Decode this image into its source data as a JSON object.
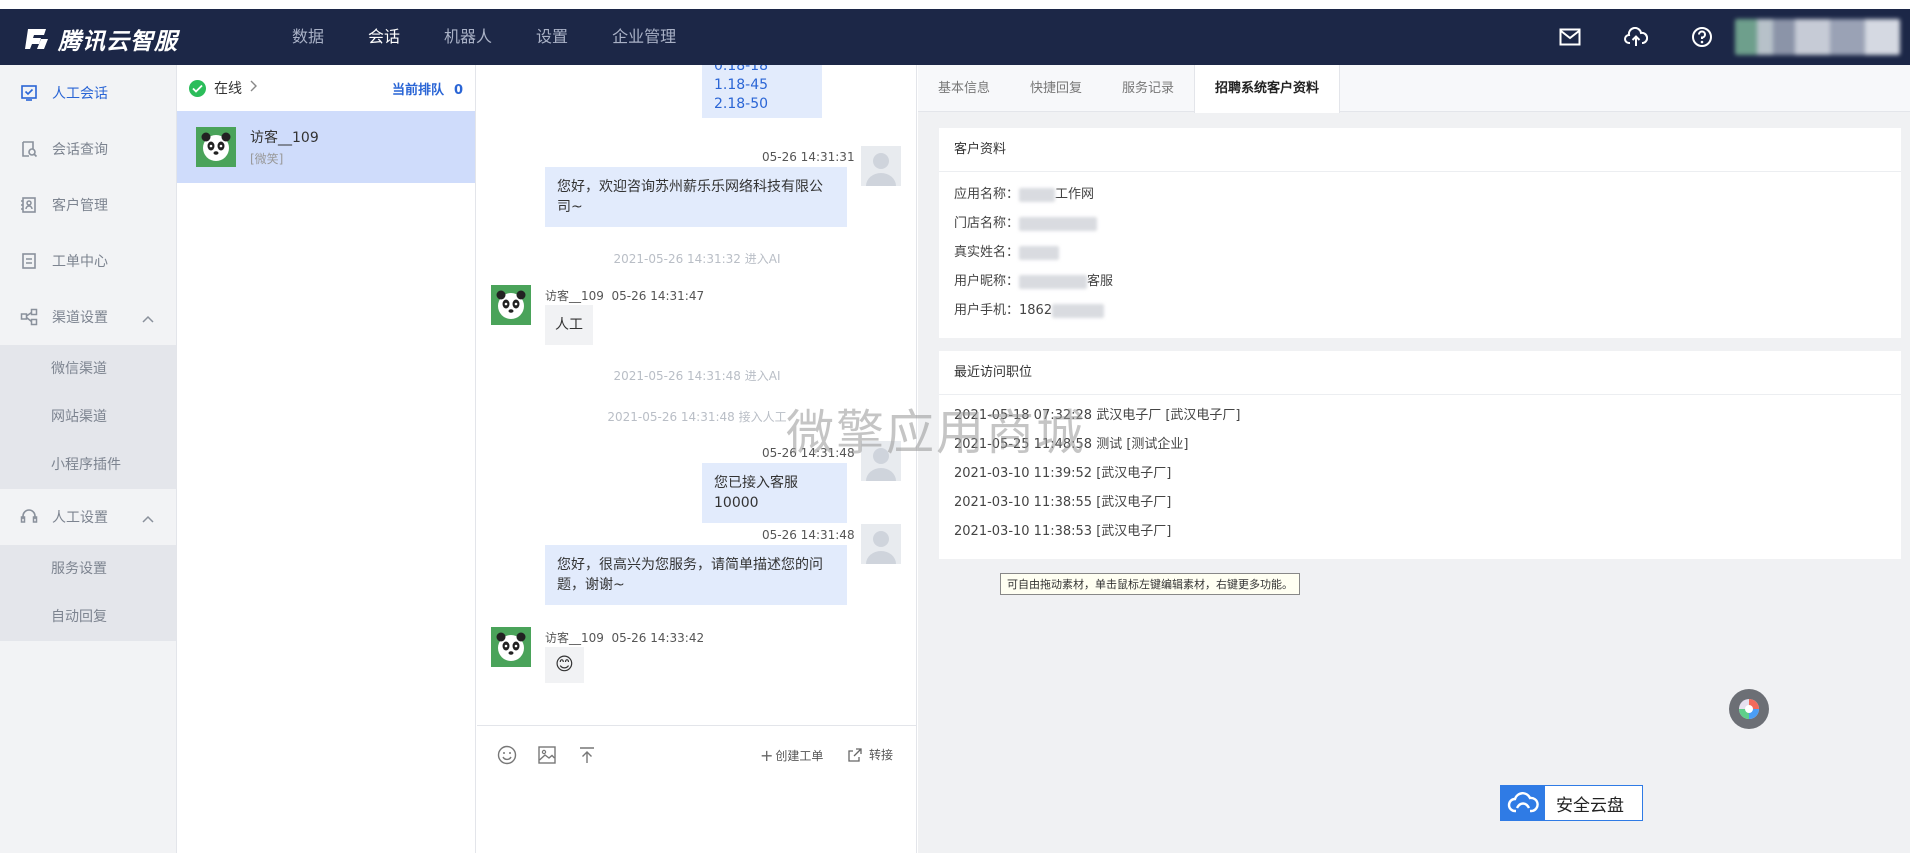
{
  "app": {
    "logo_text": "腾讯云智服"
  },
  "nav": [
    "数据",
    "会话",
    "机器人",
    "设置",
    "企业管理"
  ],
  "sidebar": {
    "items": [
      {
        "label": "人工会话",
        "icon": "chat-icon"
      },
      {
        "label": "会话查询",
        "icon": "search-doc-icon"
      },
      {
        "label": "客户管理",
        "icon": "contact-icon"
      },
      {
        "label": "工单中心",
        "icon": "ticket-icon"
      },
      {
        "label": "渠道设置",
        "icon": "share-icon"
      },
      {
        "label": "人工设置",
        "icon": "headset-icon"
      }
    ],
    "channel_sub": [
      "微信渠道",
      "网站渠道",
      "小程序插件"
    ],
    "manual_sub": [
      "服务设置",
      "自动回复"
    ]
  },
  "convlist": {
    "status": "在线",
    "queue_label": "当前排队",
    "queue_count": "0",
    "item": {
      "name": "访客__109",
      "sub": "[微笑]"
    }
  },
  "chat": {
    "top_partial": [
      "0.18-18",
      "1.18-45",
      "2.18-50"
    ],
    "m1_time": "05-26 14:31:31",
    "m1_text": "您好，欢迎咨询苏州薪乐乐网络科技有限公司~",
    "sys1": "2021-05-26 14:31:32 进入AI",
    "v1_meta": "访客__109  05-26 14:31:47",
    "v1_text": "人工",
    "sys2": "2021-05-26 14:31:48 进入AI",
    "sys3": "2021-05-26 14:31:48 接入人工",
    "m2_time": "05-26 14:31:48",
    "m2_text": "您已接入客服10000",
    "m3_time": "05-26 14:31:48",
    "m3_text": "您好，很高兴为您服务，请简单描述您的问题，谢谢~",
    "v2_meta": "访客__109  05-26 14:33:42",
    "v2_emoji": "😊",
    "create_ticket": "创建工单",
    "transfer": "转接"
  },
  "right": {
    "tabs": [
      "基本信息",
      "快捷回复",
      "服务记录",
      "招聘系统客户资料"
    ],
    "profile_title": "客户资料",
    "profile": [
      {
        "label": "应用名称：",
        "value": "工作网"
      },
      {
        "label": "门店名称：",
        "value": ""
      },
      {
        "label": "真实姓名：",
        "value": ""
      },
      {
        "label": "用户昵称：",
        "value": "客服"
      },
      {
        "label": "用户手机：",
        "value": "1862"
      }
    ],
    "visits_title": "最近访问职位",
    "visits": [
      "2021-05-18 07:32:28 武汉电子厂 [武汉电子厂]",
      "2021-05-25 11:48:58 测试 [测试企业]",
      "2021-03-10 11:39:52 [武汉电子厂]",
      "2021-03-10 11:38:55 [武汉电子厂]",
      "2021-03-10 11:38:53 [武汉电子厂]"
    ]
  },
  "tooltip": "可自由拖动素材，单击鼠标左键编辑素材，右键更多功能。",
  "watermark": "微擎应用商城",
  "cloud_button": "安全云盘",
  "colors": {
    "topbar": "#1c2747",
    "accent": "#2a65d5",
    "online": "#2bbd5a",
    "selected": "#cfdcfb"
  }
}
